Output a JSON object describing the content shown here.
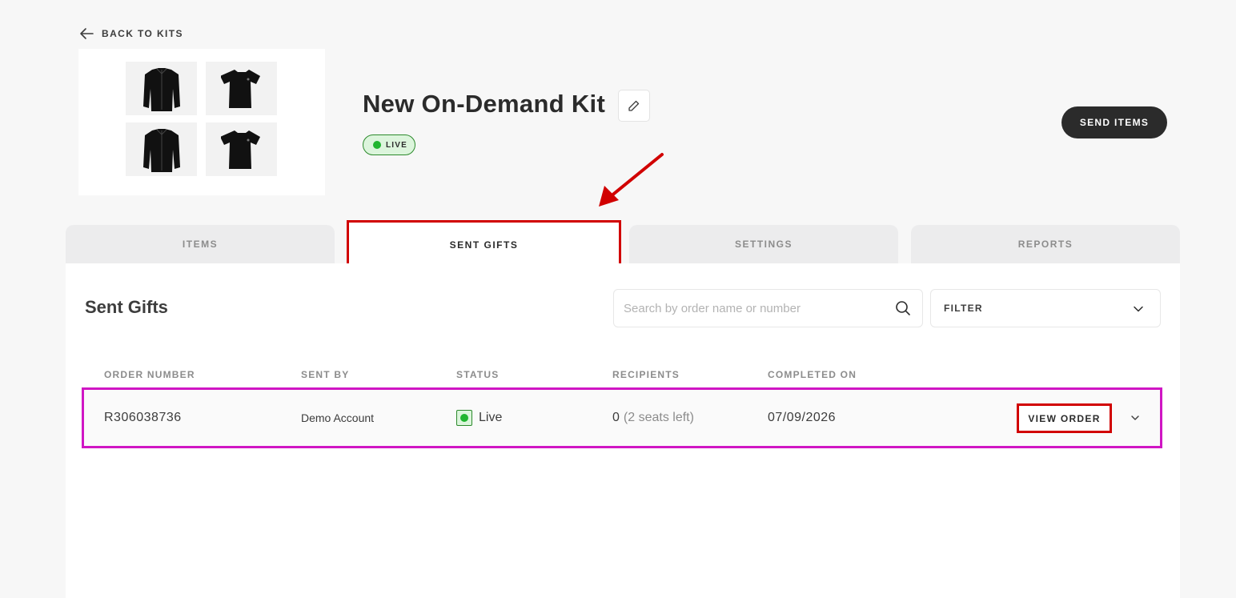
{
  "nav": {
    "back_label": "BACK TO KITS"
  },
  "kit": {
    "title": "New On-Demand Kit",
    "status_badge": "LIVE",
    "thumbnails": [
      "jacket-icon",
      "tshirt-icon",
      "jacket-icon",
      "tshirt-icon"
    ]
  },
  "actions": {
    "send_label": "SEND ITEMS"
  },
  "tabs": [
    {
      "label": "ITEMS",
      "active": false
    },
    {
      "label": "SENT GIFTS",
      "active": true
    },
    {
      "label": "SETTINGS",
      "active": false
    },
    {
      "label": "REPORTS",
      "active": false
    }
  ],
  "panel": {
    "title": "Sent Gifts",
    "search_placeholder": "Search by order name or number",
    "filter_label": "FILTER"
  },
  "table": {
    "columns": [
      "ORDER NUMBER",
      "SENT BY",
      "STATUS",
      "RECIPIENTS",
      "COMPLETED ON"
    ],
    "rows": [
      {
        "order_number": "R306038736",
        "sent_by": "Demo Account",
        "status": "Live",
        "recipients": "0",
        "seats_left": "(2 seats left)",
        "completed_on": "07/09/2026",
        "action_label": "VIEW ORDER"
      }
    ]
  },
  "colors": {
    "accent_dark": "#2b2b2b",
    "live_green": "#21b530",
    "annotation_red": "#d10000",
    "annotation_magenta": "#d016c4"
  }
}
